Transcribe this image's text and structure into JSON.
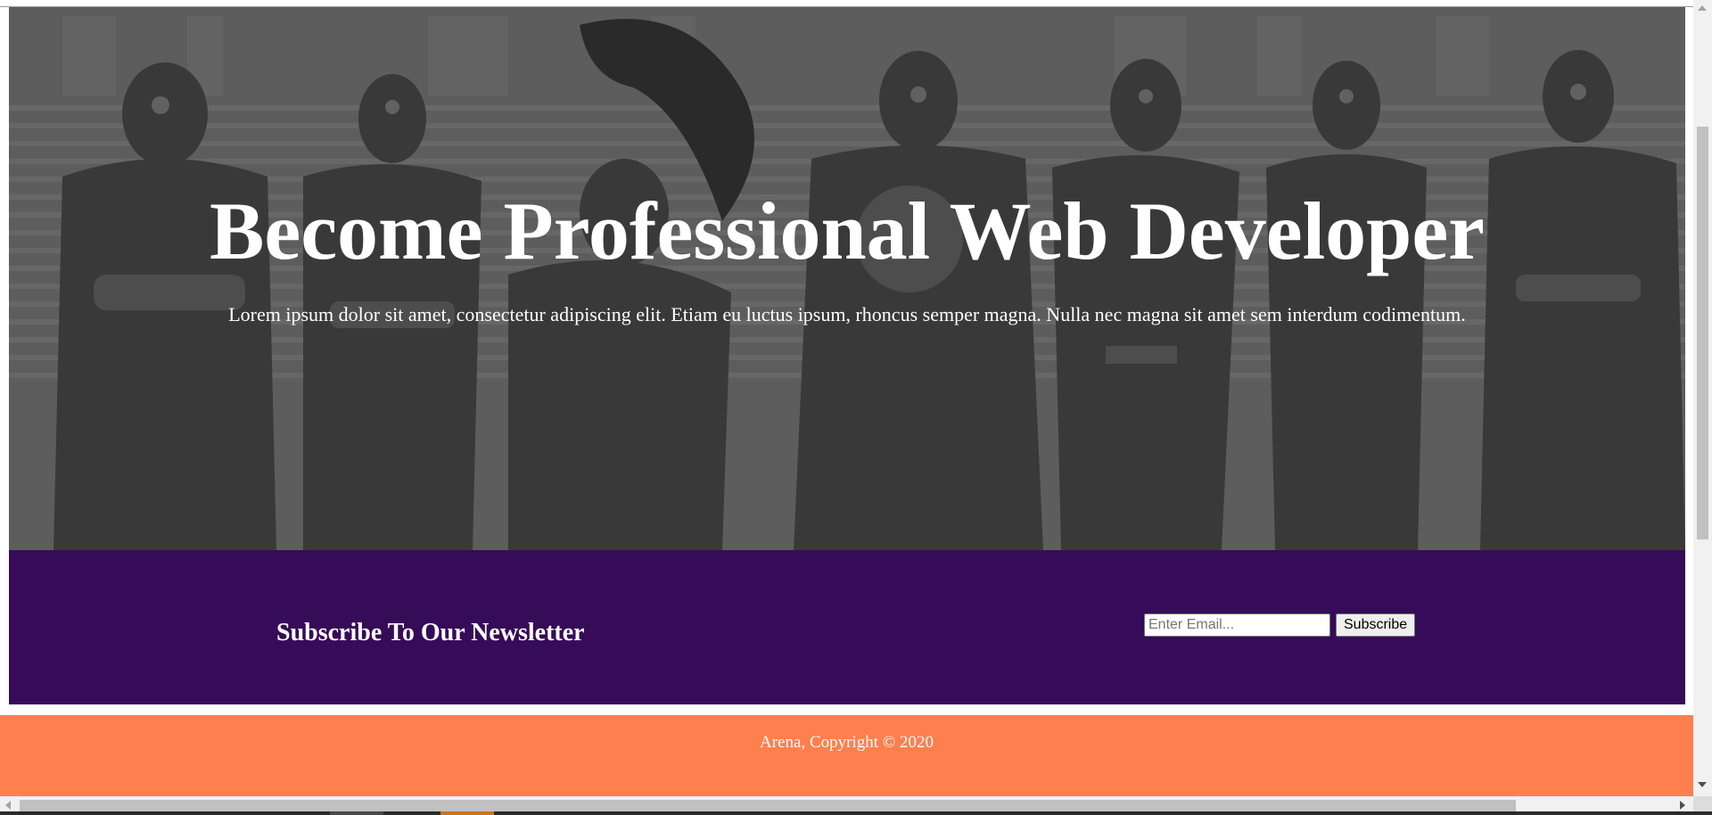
{
  "hero": {
    "title": "Become Professional Web Developer",
    "text": "Lorem ipsum dolor sit amet, consectetur adipiscing elit. Etiam eu luctus ipsum, rhoncus semper magna. Nulla nec magna sit amet sem interdum codimentum.",
    "background_image": "grayscale-superhero-team-illustration"
  },
  "newsletter": {
    "title": "Subscribe To Our Newsletter",
    "email_placeholder": "Enter Email...",
    "email_value": "",
    "subscribe_label": "Subscribe",
    "background_color": "#360b58"
  },
  "footer": {
    "text": "Arena, Copyright © 2020",
    "background_color": "#ff7f4e"
  },
  "scrollbars": {
    "vertical": "visible",
    "horizontal": "visible"
  }
}
